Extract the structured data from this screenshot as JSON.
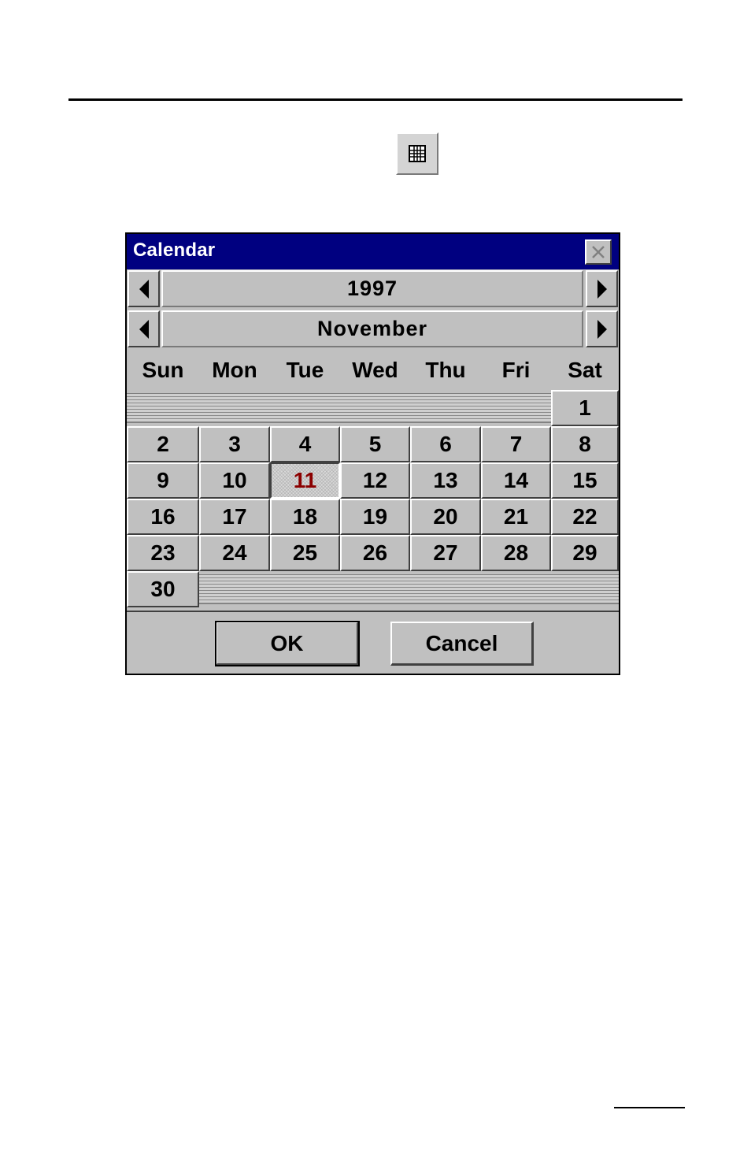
{
  "toolbar": {
    "calendar_button_icon": "calendar-grid-icon"
  },
  "dialog": {
    "title": "Calendar",
    "close_icon": "close-icon",
    "year": "1997",
    "month": "November",
    "weekdays": [
      "Sun",
      "Mon",
      "Tue",
      "Wed",
      "Thu",
      "Fri",
      "Sat"
    ],
    "weeks": [
      [
        "",
        "",
        "",
        "",
        "",
        "",
        "1"
      ],
      [
        "2",
        "3",
        "4",
        "5",
        "6",
        "7",
        "8"
      ],
      [
        "9",
        "10",
        "11",
        "12",
        "13",
        "14",
        "15"
      ],
      [
        "16",
        "17",
        "18",
        "19",
        "20",
        "21",
        "22"
      ],
      [
        "23",
        "24",
        "25",
        "26",
        "27",
        "28",
        "29"
      ],
      [
        "30",
        "",
        "",
        "",
        "",
        "",
        ""
      ]
    ],
    "selected_day": "11",
    "ok_label": "OK",
    "cancel_label": "Cancel",
    "colors": {
      "titlebar": "#000080",
      "face": "#c0c0c0",
      "selected_text": "#8b0000"
    }
  }
}
